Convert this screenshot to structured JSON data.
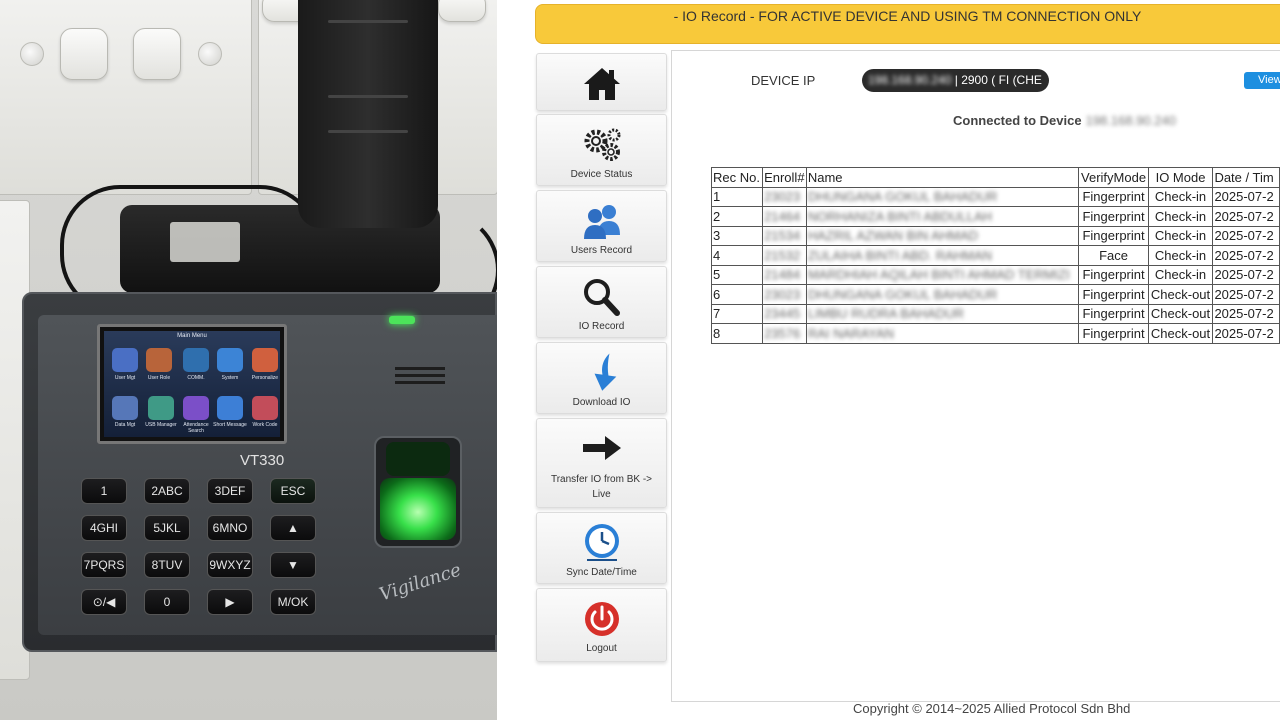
{
  "device_photo": {
    "lcd_title": "Main Menu",
    "lcd_items": [
      "User Mgt",
      "User Role",
      "COMM.",
      "System",
      "Personalize",
      "Data Mgt",
      "USB Manager",
      "Attendance Search",
      "Short Message",
      "Work Code"
    ],
    "model": "VT330",
    "keys": [
      "1",
      "2ABC",
      "3DEF",
      "ESC",
      "4GHI",
      "5JKL",
      "6MNO",
      "▲",
      "7PQRS",
      "8TUV",
      "9WXYZ",
      "▼",
      "⊙/◀",
      "0",
      "▶",
      "M/OK"
    ],
    "brand": "Vigilance"
  },
  "banner": {
    "text": "- IO Record - FOR ACTIVE DEVICE AND USING TM CONNECTION ONLY",
    "color": "#f8c93a"
  },
  "sidebar": {
    "items": [
      {
        "label": "",
        "icon": "home-icon"
      },
      {
        "label": "Device Status",
        "icon": "gears-icon"
      },
      {
        "label": "Users Record",
        "icon": "users-icon"
      },
      {
        "label": "IO Record",
        "icon": "magnifier-icon"
      },
      {
        "label": "Download IO",
        "icon": "download-arrow-icon"
      },
      {
        "label": "Transfer IO from BK -> Live",
        "icon": "right-arrow-icon"
      },
      {
        "label": "Sync Date/Time",
        "icon": "clock-icon"
      },
      {
        "label": "Logout",
        "icon": "power-icon"
      }
    ]
  },
  "main": {
    "device_ip_label": "DEVICE IP",
    "device_ip_blurred": "198.168.90.240",
    "device_ip_suffix": " | 2900 ( FI (CHE",
    "view_button": "View",
    "connected_label": "Connected to Device",
    "connected_ip": "198.168.90.240",
    "table": {
      "headers": [
        "Rec No.",
        "Enroll#",
        "Name",
        "VerifyMode",
        "IO Mode",
        "Date / Tim"
      ],
      "rows": [
        {
          "rec": "1",
          "enroll": "23023",
          "name": "DHUNGANA GOKUL BAHADUR",
          "verify": "Fingerprint",
          "io": "Check-in",
          "date": "2025-07-2"
        },
        {
          "rec": "2",
          "enroll": "21464",
          "name": "NORHANIZA BINTI ABDULLAH",
          "verify": "Fingerprint",
          "io": "Check-in",
          "date": "2025-07-2"
        },
        {
          "rec": "3",
          "enroll": "21534",
          "name": "HAZRIL AZWAN BIN AHMAD",
          "verify": "Fingerprint",
          "io": "Check-in",
          "date": "2025-07-2"
        },
        {
          "rec": "4",
          "enroll": "21532",
          "name": "ZULAIHA BINTI ABD. RAHMAN",
          "verify": "Face",
          "io": "Check-in",
          "date": "2025-07-2"
        },
        {
          "rec": "5",
          "enroll": "21484",
          "name": "MARDHIAH AQILAH BINTI AHMAD TERMIZI",
          "verify": "Fingerprint",
          "io": "Check-in",
          "date": "2025-07-2"
        },
        {
          "rec": "6",
          "enroll": "23023",
          "name": "DHUNGANA GOKUL BAHADUR",
          "verify": "Fingerprint",
          "io": "Check-out",
          "date": "2025-07-2"
        },
        {
          "rec": "7",
          "enroll": "23445",
          "name": "LIMBU RUDRA BAHADUR",
          "verify": "Fingerprint",
          "io": "Check-out",
          "date": "2025-07-2"
        },
        {
          "rec": "8",
          "enroll": "23576",
          "name": "RAI NARAYAN",
          "verify": "Fingerprint",
          "io": "Check-out",
          "date": "2025-07-2"
        }
      ]
    }
  },
  "footer": {
    "copyright": "Copyright © 2014~2025 Allied Protocol Sdn Bhd"
  }
}
